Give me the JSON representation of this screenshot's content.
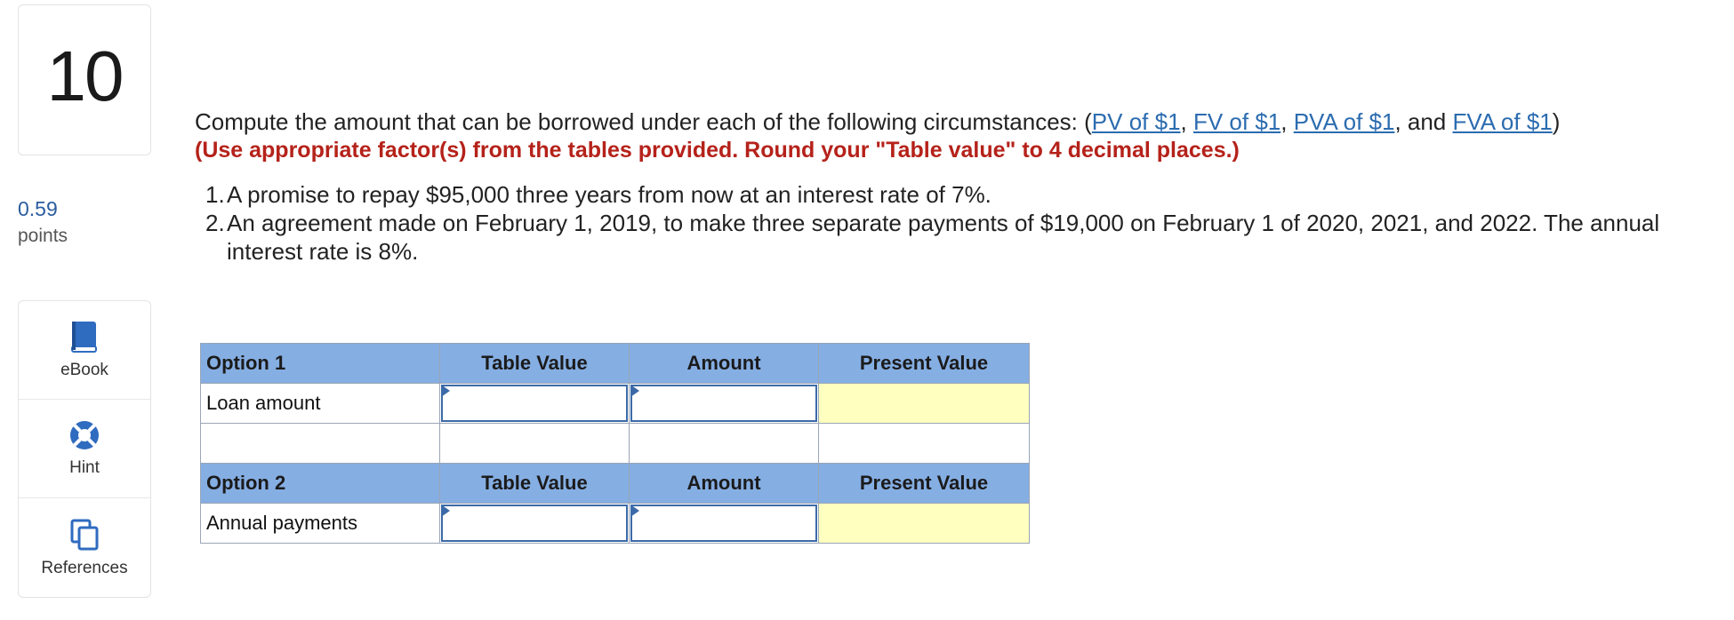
{
  "question": {
    "number": "10",
    "points_value": "0.59",
    "points_label": "points",
    "prompt": "Compute the amount that can be borrowed under each of the following circumstances: (",
    "links": [
      "PV of $1",
      "FV of $1",
      "PVA of $1",
      "FVA of $1"
    ],
    "instruction": "(Use appropriate factor(s) from the tables provided. Round your \"Table value\" to 4 decimal places.)",
    "items": [
      {
        "num": "1.",
        "text": "A promise to repay $95,000 three years from now at an interest rate of 7%."
      },
      {
        "num": "2.",
        "text": "An agreement made on February 1, 2019, to make three separate payments of $19,000 on February 1 of 2020, 2021, and 2022. The annual interest rate is 8%."
      }
    ]
  },
  "tools": [
    {
      "label": "eBook",
      "icon": "book-icon"
    },
    {
      "label": "Hint",
      "icon": "lifebuoy-icon"
    },
    {
      "label": "References",
      "icon": "copy-pages-icon"
    }
  ],
  "table": {
    "option1": {
      "header": [
        "Option 1",
        "Table Value",
        "Amount",
        "Present Value"
      ],
      "row_label": "Loan amount",
      "table_value": "",
      "amount": "",
      "present_value": ""
    },
    "option2": {
      "header": [
        "Option 2",
        "Table Value",
        "Amount",
        "Present Value"
      ],
      "row_label": "Annual payments",
      "table_value": "",
      "amount": "",
      "present_value": ""
    }
  },
  "colors": {
    "link": "#2b6cb0",
    "instruction": "#b5221a",
    "header_bg": "#85aee3",
    "pv_bg": "#ffffc0",
    "points": "#2b5d9f"
  }
}
